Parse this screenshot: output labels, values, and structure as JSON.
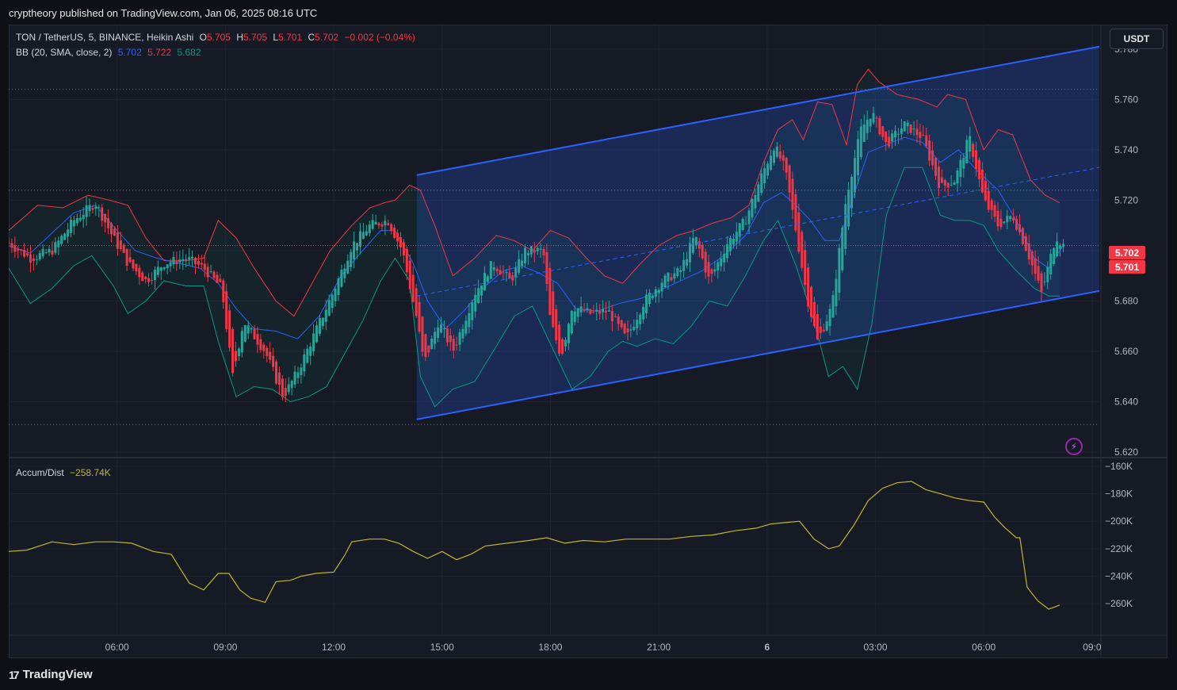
{
  "header": {
    "publish_text": "cryptheory published on TradingView.com, Jan 06, 2025 08:16 UTC"
  },
  "legend": {
    "symbol": "TON / TetherUS, 5, BINANCE, Heikin Ashi",
    "o_label": "O",
    "o_value": "5.705",
    "h_label": "H",
    "h_value": "5.705",
    "l_label": "L",
    "l_value": "5.701",
    "c_label": "C",
    "c_value": "5.702",
    "change": "−0.002 (−0.04%)",
    "bb_label": "BB (20, SMA, close, 2)",
    "bb_basis": "5.702",
    "bb_upper": "5.722",
    "bb_lower": "5.682",
    "ad_label": "Accum/Dist",
    "ad_value": "−258.74K"
  },
  "currency_button": "USDT",
  "price_labels": {
    "last": "5.702",
    "bid": "5.701"
  },
  "footer": {
    "brand": "TradingView",
    "logo": "17"
  },
  "colors": {
    "up": "#26a69a",
    "down": "#f23645",
    "bb_basis": "#2962ff",
    "bb_upper": "#f23645",
    "bb_lower": "#089981",
    "channel": "#2962ff",
    "ad_line": "#c2b62a",
    "background": "#161a25"
  },
  "chart_data": [
    {
      "type": "candlestick",
      "title": "TON / TetherUS, 5, BINANCE, Heikin Ashi",
      "ylim": [
        5.615,
        5.785
      ],
      "y_ticks": [
        "5.780",
        "5.760",
        "5.740",
        "5.720",
        "5.700",
        "5.680",
        "5.660",
        "5.640",
        "5.620"
      ],
      "y_tick_values": [
        5.78,
        5.76,
        5.74,
        5.72,
        5.7,
        5.68,
        5.66,
        5.64,
        5.62
      ],
      "x_ticks": [
        "06:00",
        "09:00",
        "12:00",
        "15:00",
        "18:00",
        "21:00",
        "6",
        "03:00",
        "06:00",
        "09:0"
      ],
      "x_tick_hours": [
        6,
        9,
        12,
        15,
        18,
        21,
        24,
        27,
        30,
        33
      ],
      "x_range_hours": [
        3.0,
        33.2
      ],
      "close_path": [
        [
          3.0,
          5.703
        ],
        [
          3.6,
          5.697
        ],
        [
          4.2,
          5.7
        ],
        [
          4.8,
          5.712
        ],
        [
          5.4,
          5.719
        ],
        [
          5.9,
          5.705
        ],
        [
          6.3,
          5.695
        ],
        [
          6.8,
          5.688
        ],
        [
          7.3,
          5.695
        ],
        [
          7.9,
          5.697
        ],
        [
          8.4,
          5.693
        ],
        [
          8.9,
          5.685
        ],
        [
          9.2,
          5.65
        ],
        [
          9.5,
          5.672
        ],
        [
          10.1,
          5.66
        ],
        [
          10.6,
          5.642
        ],
        [
          11.0,
          5.652
        ],
        [
          11.5,
          5.668
        ],
        [
          12.0,
          5.684
        ],
        [
          12.5,
          5.702
        ],
        [
          13.0,
          5.71
        ],
        [
          13.5,
          5.712
        ],
        [
          13.9,
          5.7
        ],
        [
          14.3,
          5.673
        ],
        [
          14.5,
          5.655
        ],
        [
          14.9,
          5.672
        ],
        [
          15.3,
          5.66
        ],
        [
          15.9,
          5.683
        ],
        [
          16.4,
          5.695
        ],
        [
          16.9,
          5.688
        ],
        [
          17.3,
          5.7
        ],
        [
          17.8,
          5.7
        ],
        [
          18.0,
          5.672
        ],
        [
          18.3,
          5.658
        ],
        [
          18.6,
          5.678
        ],
        [
          19.1,
          5.675
        ],
        [
          19.6,
          5.676
        ],
        [
          20.1,
          5.665
        ],
        [
          20.6,
          5.68
        ],
        [
          21.1,
          5.688
        ],
        [
          21.6,
          5.692
        ],
        [
          22.0,
          5.706
        ],
        [
          22.4,
          5.688
        ],
        [
          22.9,
          5.703
        ],
        [
          23.4,
          5.712
        ],
        [
          23.8,
          5.728
        ],
        [
          24.2,
          5.742
        ],
        [
          24.5,
          5.732
        ],
        [
          24.8,
          5.708
        ],
        [
          25.1,
          5.682
        ],
        [
          25.4,
          5.664
        ],
        [
          25.8,
          5.678
        ],
        [
          26.2,
          5.722
        ],
        [
          26.6,
          5.748
        ],
        [
          26.9,
          5.755
        ],
        [
          27.3,
          5.742
        ],
        [
          27.8,
          5.75
        ],
        [
          28.3,
          5.745
        ],
        [
          28.8,
          5.725
        ],
        [
          29.2,
          5.728
        ],
        [
          29.6,
          5.745
        ],
        [
          30.0,
          5.72
        ],
        [
          30.4,
          5.71
        ],
        [
          30.8,
          5.714
        ],
        [
          31.2,
          5.7
        ],
        [
          31.6,
          5.683
        ],
        [
          32.0,
          5.706
        ],
        [
          32.2,
          5.702
        ]
      ],
      "bb_upper_path": [
        [
          3.0,
          5.708
        ],
        [
          3.8,
          5.718
        ],
        [
          4.5,
          5.717
        ],
        [
          5.2,
          5.722
        ],
        [
          5.8,
          5.72
        ],
        [
          6.3,
          5.718
        ],
        [
          6.8,
          5.705
        ],
        [
          7.3,
          5.696
        ],
        [
          7.9,
          5.696
        ],
        [
          8.4,
          5.697
        ],
        [
          8.8,
          5.712
        ],
        [
          9.3,
          5.705
        ],
        [
          9.8,
          5.693
        ],
        [
          10.4,
          5.68
        ],
        [
          10.9,
          5.674
        ],
        [
          11.4,
          5.687
        ],
        [
          11.9,
          5.7
        ],
        [
          12.5,
          5.71
        ],
        [
          13.0,
          5.717
        ],
        [
          13.4,
          5.719
        ],
        [
          13.7,
          5.72
        ],
        [
          14.1,
          5.726
        ],
        [
          14.4,
          5.724
        ],
        [
          14.8,
          5.71
        ],
        [
          15.3,
          5.69
        ],
        [
          15.9,
          5.697
        ],
        [
          16.5,
          5.706
        ],
        [
          17.0,
          5.704
        ],
        [
          17.5,
          5.7
        ],
        [
          18.0,
          5.708
        ],
        [
          18.5,
          5.705
        ],
        [
          19.0,
          5.697
        ],
        [
          19.5,
          5.69
        ],
        [
          20.0,
          5.687
        ],
        [
          20.5,
          5.695
        ],
        [
          21.0,
          5.702
        ],
        [
          21.5,
          5.706
        ],
        [
          22.0,
          5.708
        ],
        [
          22.5,
          5.711
        ],
        [
          23.0,
          5.713
        ],
        [
          23.5,
          5.718
        ],
        [
          23.9,
          5.735
        ],
        [
          24.3,
          5.748
        ],
        [
          24.7,
          5.752
        ],
        [
          25.0,
          5.744
        ],
        [
          25.4,
          5.759
        ],
        [
          25.8,
          5.758
        ],
        [
          26.2,
          5.742
        ],
        [
          26.5,
          5.766
        ],
        [
          26.8,
          5.772
        ],
        [
          27.1,
          5.767
        ],
        [
          27.6,
          5.762
        ],
        [
          28.2,
          5.76
        ],
        [
          28.7,
          5.757
        ],
        [
          29.0,
          5.762
        ],
        [
          29.5,
          5.76
        ],
        [
          30.0,
          5.74
        ],
        [
          30.4,
          5.748
        ],
        [
          30.8,
          5.746
        ],
        [
          31.3,
          5.728
        ],
        [
          31.7,
          5.722
        ],
        [
          32.1,
          5.719
        ]
      ],
      "bb_basis_path": [
        [
          3.0,
          5.702
        ],
        [
          3.6,
          5.699
        ],
        [
          4.2,
          5.707
        ],
        [
          4.8,
          5.715
        ],
        [
          5.4,
          5.718
        ],
        [
          6.0,
          5.708
        ],
        [
          6.5,
          5.7
        ],
        [
          7.1,
          5.697
        ],
        [
          7.7,
          5.695
        ],
        [
          8.3,
          5.693
        ],
        [
          8.8,
          5.687
        ],
        [
          9.3,
          5.677
        ],
        [
          9.8,
          5.669
        ],
        [
          10.4,
          5.668
        ],
        [
          11.0,
          5.665
        ],
        [
          11.6,
          5.674
        ],
        [
          12.2,
          5.69
        ],
        [
          12.8,
          5.7
        ],
        [
          13.3,
          5.708
        ],
        [
          13.7,
          5.708
        ],
        [
          14.2,
          5.695
        ],
        [
          14.6,
          5.68
        ],
        [
          15.1,
          5.669
        ],
        [
          15.6,
          5.676
        ],
        [
          16.2,
          5.686
        ],
        [
          16.7,
          5.692
        ],
        [
          17.2,
          5.694
        ],
        [
          17.7,
          5.691
        ],
        [
          18.2,
          5.687
        ],
        [
          18.7,
          5.677
        ],
        [
          19.3,
          5.676
        ],
        [
          19.9,
          5.679
        ],
        [
          20.5,
          5.681
        ],
        [
          21.0,
          5.684
        ],
        [
          21.6,
          5.688
        ],
        [
          22.2,
          5.692
        ],
        [
          22.8,
          5.698
        ],
        [
          23.4,
          5.706
        ],
        [
          23.9,
          5.719
        ],
        [
          24.4,
          5.723
        ],
        [
          24.8,
          5.718
        ],
        [
          25.2,
          5.712
        ],
        [
          25.6,
          5.704
        ],
        [
          26.0,
          5.704
        ],
        [
          26.4,
          5.722
        ],
        [
          26.8,
          5.739
        ],
        [
          27.3,
          5.742
        ],
        [
          27.8,
          5.745
        ],
        [
          28.3,
          5.743
        ],
        [
          28.8,
          5.735
        ],
        [
          29.3,
          5.74
        ],
        [
          29.8,
          5.732
        ],
        [
          30.4,
          5.724
        ],
        [
          30.9,
          5.712
        ],
        [
          31.4,
          5.697
        ],
        [
          31.8,
          5.693
        ],
        [
          32.2,
          5.702
        ]
      ],
      "bb_lower_path": [
        [
          3.0,
          5.693
        ],
        [
          3.6,
          5.679
        ],
        [
          4.2,
          5.685
        ],
        [
          4.8,
          5.694
        ],
        [
          5.3,
          5.698
        ],
        [
          5.9,
          5.686
        ],
        [
          6.3,
          5.675
        ],
        [
          6.8,
          5.68
        ],
        [
          7.3,
          5.688
        ],
        [
          7.9,
          5.686
        ],
        [
          8.4,
          5.686
        ],
        [
          8.8,
          5.664
        ],
        [
          9.3,
          5.642
        ],
        [
          9.8,
          5.646
        ],
        [
          10.3,
          5.645
        ],
        [
          10.8,
          5.64
        ],
        [
          11.3,
          5.642
        ],
        [
          11.8,
          5.646
        ],
        [
          12.3,
          5.659
        ],
        [
          12.8,
          5.672
        ],
        [
          13.3,
          5.688
        ],
        [
          13.7,
          5.697
        ],
        [
          14.1,
          5.688
        ],
        [
          14.4,
          5.65
        ],
        [
          14.8,
          5.638
        ],
        [
          15.3,
          5.645
        ],
        [
          15.9,
          5.648
        ],
        [
          16.5,
          5.662
        ],
        [
          17.0,
          5.674
        ],
        [
          17.5,
          5.678
        ],
        [
          18.1,
          5.66
        ],
        [
          18.6,
          5.645
        ],
        [
          19.1,
          5.65
        ],
        [
          19.6,
          5.66
        ],
        [
          20.0,
          5.664
        ],
        [
          20.4,
          5.662
        ],
        [
          20.9,
          5.665
        ],
        [
          21.4,
          5.663
        ],
        [
          21.9,
          5.67
        ],
        [
          22.4,
          5.68
        ],
        [
          22.9,
          5.678
        ],
        [
          23.4,
          5.69
        ],
        [
          23.9,
          5.704
        ],
        [
          24.3,
          5.712
        ],
        [
          24.8,
          5.694
        ],
        [
          25.3,
          5.672
        ],
        [
          25.7,
          5.65
        ],
        [
          26.1,
          5.654
        ],
        [
          26.5,
          5.645
        ],
        [
          26.9,
          5.671
        ],
        [
          27.3,
          5.714
        ],
        [
          27.8,
          5.733
        ],
        [
          28.3,
          5.733
        ],
        [
          28.8,
          5.714
        ],
        [
          29.2,
          5.712
        ],
        [
          29.6,
          5.712
        ],
        [
          30.0,
          5.71
        ],
        [
          30.4,
          5.7
        ],
        [
          30.9,
          5.692
        ],
        [
          31.4,
          5.685
        ],
        [
          31.8,
          5.682
        ],
        [
          32.1,
          5.682
        ]
      ],
      "channel": {
        "upper": [
          [
            14.3,
            5.73
          ],
          [
            33.2,
            5.781
          ]
        ],
        "lower": [
          [
            14.3,
            5.633
          ],
          [
            33.2,
            5.684
          ]
        ],
        "mid": [
          [
            14.3,
            5.682
          ],
          [
            33.2,
            5.733
          ]
        ]
      },
      "horizontal_levels": [
        5.764,
        5.724,
        5.631
      ],
      "last_price": 5.702
    },
    {
      "type": "line",
      "title": "Accum/Dist",
      "ylim": [
        -268,
        -156
      ],
      "y_ticks": [
        "−160K",
        "−180K",
        "−200K",
        "−220K",
        "−240K",
        "−260K"
      ],
      "y_tick_values": [
        -160,
        -180,
        -200,
        -220,
        -240,
        -260
      ],
      "x": [
        3.0,
        3.5,
        4.2,
        4.8,
        5.4,
        5.9,
        6.4,
        7.0,
        7.5,
        8.0,
        8.4,
        8.8,
        9.1,
        9.4,
        9.7,
        10.1,
        10.4,
        10.8,
        11.1,
        11.5,
        12.0,
        12.3,
        12.5,
        13.0,
        13.4,
        13.8,
        14.2,
        14.6,
        15.0,
        15.4,
        15.8,
        16.2,
        16.8,
        17.4,
        17.9,
        18.4,
        18.9,
        19.5,
        20.1,
        20.7,
        21.3,
        21.9,
        22.5,
        23.1,
        23.7,
        24.1,
        24.5,
        24.9,
        25.3,
        25.7,
        26.0,
        26.4,
        26.8,
        27.2,
        27.6,
        28.0,
        28.4,
        28.8,
        29.2,
        29.6,
        30.0,
        30.3,
        30.6,
        30.9,
        31.0,
        31.2,
        31.5,
        31.8,
        32.1
      ],
      "y": [
        -222,
        -221,
        -215,
        -217,
        -215,
        -215,
        -216,
        -222,
        -224,
        -245,
        -250,
        -238,
        -238,
        -250,
        -256,
        -259,
        -244,
        -243,
        -240,
        -238,
        -237,
        -225,
        -215,
        -213,
        -213,
        -216,
        -222,
        -227,
        -222,
        -228,
        -224,
        -218,
        -216,
        -214,
        -212,
        -216,
        -214,
        -215,
        -213,
        -213,
        -213,
        -211,
        -210,
        -207,
        -205,
        -202,
        -201,
        -200,
        -213,
        -220,
        -218,
        -203,
        -185,
        -176,
        -172,
        -171,
        -177,
        -180,
        -183,
        -185,
        -186,
        -197,
        -205,
        -212,
        -212,
        -248,
        -258,
        -264,
        -261
      ]
    }
  ]
}
